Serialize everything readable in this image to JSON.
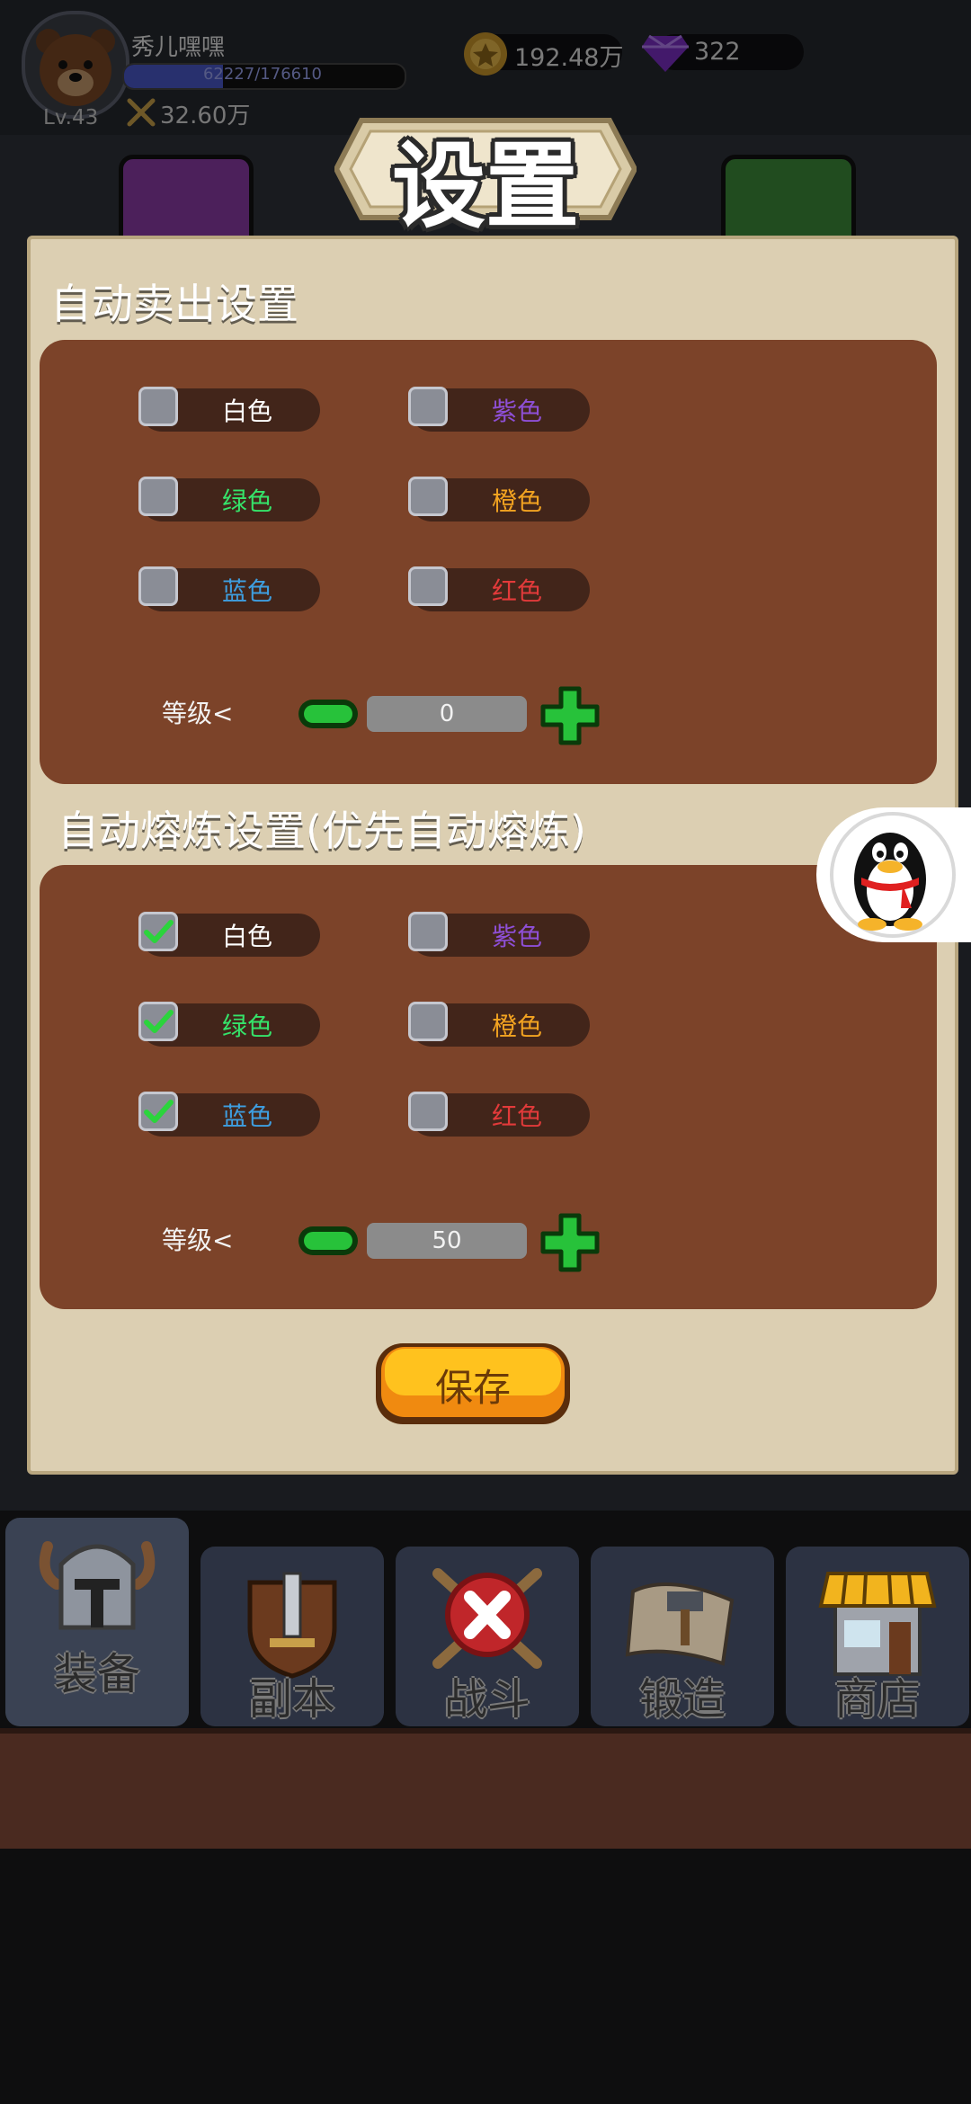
{
  "player": {
    "name": "秀儿嘿嘿",
    "exp_text": "62227/176610",
    "exp_fraction": 0.352,
    "level": "Lv.43",
    "power": "32.60万"
  },
  "currency": {
    "coins": "192.48万",
    "gems": "322"
  },
  "dialog": {
    "title": "设置",
    "sell_section": {
      "title": "自动卖出设置",
      "options": [
        {
          "label": "白色",
          "color": "#ffffff",
          "checked": false
        },
        {
          "label": "紫色",
          "color": "#8e4fd6",
          "checked": false
        },
        {
          "label": "绿色",
          "color": "#35e36a",
          "checked": false
        },
        {
          "label": "橙色",
          "color": "#f2a321",
          "checked": false
        },
        {
          "label": "蓝色",
          "color": "#3e9ee0",
          "checked": false
        },
        {
          "label": "红色",
          "color": "#e23a3a",
          "checked": false
        }
      ],
      "level_label": "等级<",
      "level_value": "0"
    },
    "smelt_section": {
      "title": "自动熔炼设置(优先自动熔炼)",
      "options": [
        {
          "label": "白色",
          "color": "#ffffff",
          "checked": true
        },
        {
          "label": "紫色",
          "color": "#8e4fd6",
          "checked": false
        },
        {
          "label": "绿色",
          "color": "#35e36a",
          "checked": true
        },
        {
          "label": "橙色",
          "color": "#f2a321",
          "checked": false
        },
        {
          "label": "蓝色",
          "color": "#3e9ee0",
          "checked": true
        },
        {
          "label": "红色",
          "color": "#e23a3a",
          "checked": false
        }
      ],
      "level_label": "等级<",
      "level_value": "50"
    },
    "save_label": "保存"
  },
  "nav": [
    {
      "label": "装备",
      "icon": "helmet-icon",
      "active": true
    },
    {
      "label": "副本",
      "icon": "sword-shield-icon",
      "active": false
    },
    {
      "label": "战斗",
      "icon": "battle-icon",
      "active": false
    },
    {
      "label": "锻造",
      "icon": "hammer-scroll-icon",
      "active": false
    },
    {
      "label": "商店",
      "icon": "shop-icon",
      "active": false
    }
  ],
  "floating": {
    "icon": "qq-penguin-icon"
  }
}
